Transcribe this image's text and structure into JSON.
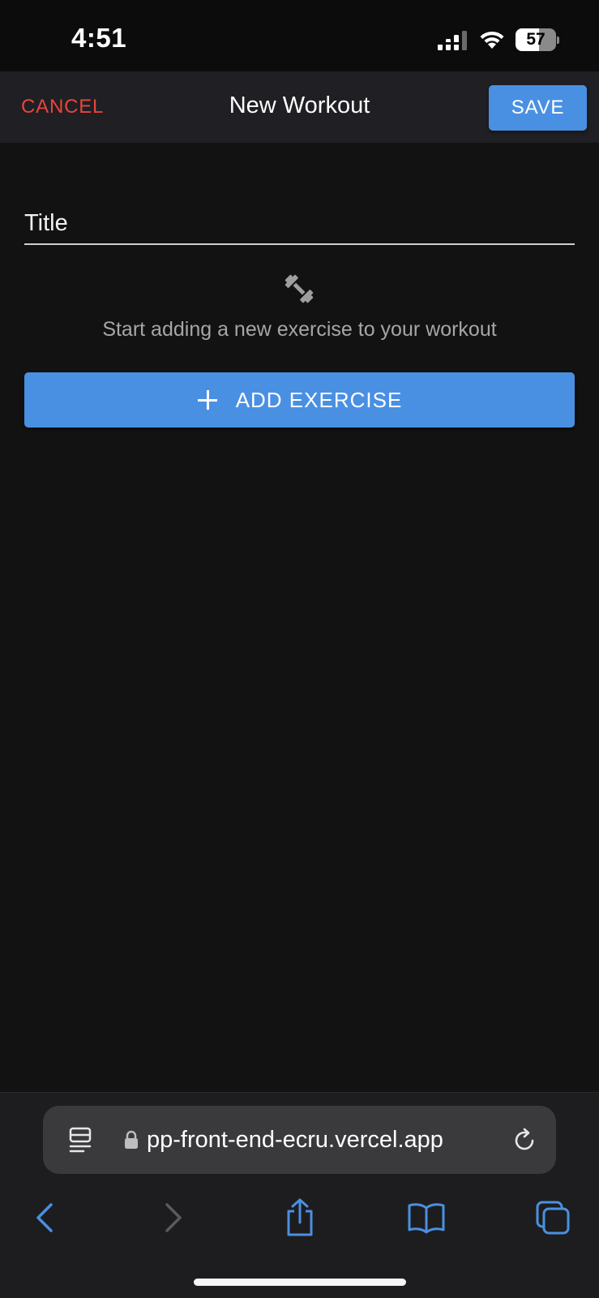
{
  "status_bar": {
    "time": "4:51",
    "battery_percent": "57",
    "battery_level": 0.57
  },
  "app_bar": {
    "cancel_label": "CANCEL",
    "title": "New Workout",
    "save_label": "SAVE"
  },
  "form": {
    "title_placeholder": "Title",
    "title_value": "",
    "empty_state_icon": "dumbbell-icon",
    "empty_state_text": "Start adding a new exercise to your workout",
    "add_exercise_label": "ADD EXERCISE"
  },
  "browser": {
    "url": "pp-front-end-ecru.vercel.app",
    "toolbar": [
      "back-icon",
      "forward-icon",
      "share-icon",
      "bookmarks-icon",
      "tabs-icon"
    ]
  },
  "colors": {
    "accent": "#4a90e2",
    "cancel": "#e8453a",
    "background": "#121212",
    "app_bar": "#1f1f24"
  }
}
